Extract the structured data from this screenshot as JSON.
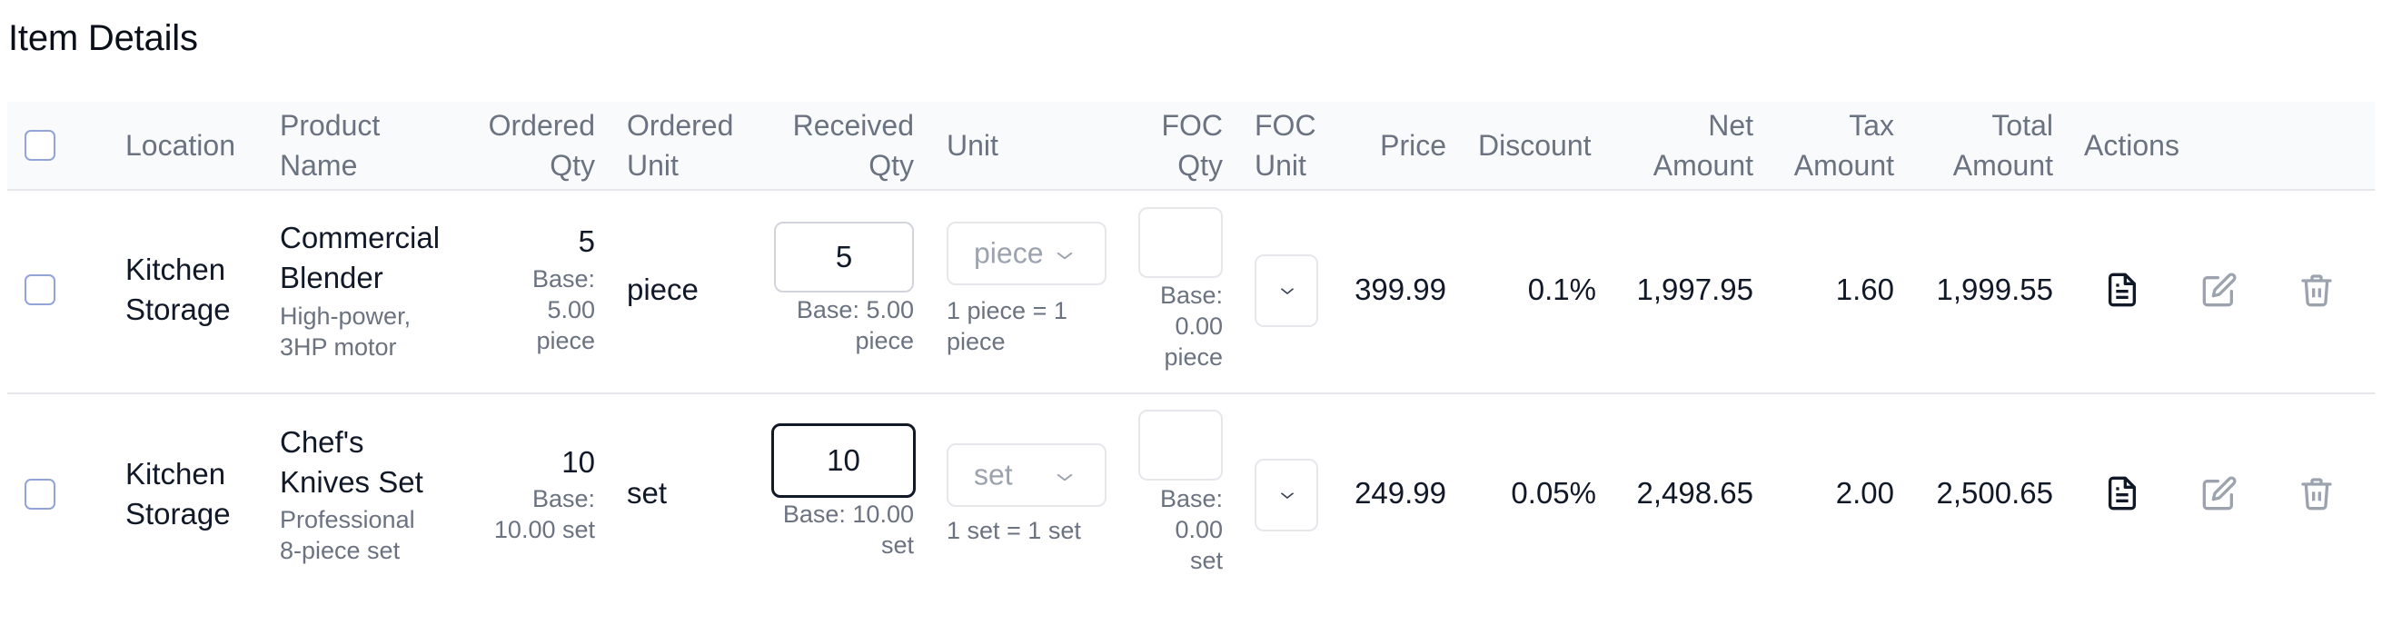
{
  "page_title": "Item Details",
  "headers": {
    "location": "Location",
    "product_name_1": "Product",
    "product_name_2": "Name",
    "ordered_qty_1": "Ordered",
    "ordered_qty_2": "Qty",
    "ordered_unit_1": "Ordered",
    "ordered_unit_2": "Unit",
    "received_qty_1": "Received",
    "received_qty_2": "Qty",
    "unit": "Unit",
    "foc_qty_1": "FOC",
    "foc_qty_2": "Qty",
    "foc_unit_1": "FOC",
    "foc_unit_2": "Unit",
    "price": "Price",
    "discount": "Discount",
    "net_amount_1": "Net",
    "net_amount_2": "Amount",
    "tax_amount_1": "Tax",
    "tax_amount_2": "Amount",
    "total_amount_1": "Total",
    "total_amount_2": "Amount",
    "actions": "Actions"
  },
  "rows": [
    {
      "location_1": "Kitchen",
      "location_2": "Storage",
      "product_1": "Commercial",
      "product_2": "Blender",
      "desc_1": "High-power,",
      "desc_2": "3HP motor",
      "ordered_qty": "5",
      "ordered_base_1": "Base:",
      "ordered_base_2": "5.00",
      "ordered_base_3": "piece",
      "ordered_unit": "piece",
      "received_qty": "5",
      "received_base_1": "Base: 5.00",
      "received_base_2": "piece",
      "unit_select": "piece",
      "conversion_1": "1 piece = 1",
      "conversion_2": "piece",
      "foc_qty": "",
      "foc_base_1": "Base:",
      "foc_base_2": "0.00",
      "foc_base_3": "piece",
      "price": "399.99",
      "discount": "0.1%",
      "net_amount": "1,997.95",
      "tax_amount": "1.60",
      "total_amount": "1,999.55"
    },
    {
      "location_1": "Kitchen",
      "location_2": "Storage",
      "product_1": "Chef's",
      "product_2": "Knives Set",
      "desc_1": "Professional",
      "desc_2": "8-piece set",
      "ordered_qty": "10",
      "ordered_base_1": "Base:",
      "ordered_base_2": "10.00 set",
      "ordered_unit": "set",
      "received_qty": "10",
      "received_base_1": "Base: 10.00",
      "received_base_2": "set",
      "unit_select": "set",
      "conversion_1": "1 set = 1 set",
      "foc_qty": "",
      "foc_base_1": "Base:",
      "foc_base_2": "0.00",
      "foc_base_3": "set",
      "price": "249.99",
      "discount": "0.05%",
      "net_amount": "2,498.65",
      "tax_amount": "2.00",
      "total_amount": "2,500.65"
    }
  ],
  "icons": {
    "view": "document-icon",
    "edit": "edit-icon",
    "delete": "trash-icon",
    "dropdown": "chevron-down-icon"
  }
}
